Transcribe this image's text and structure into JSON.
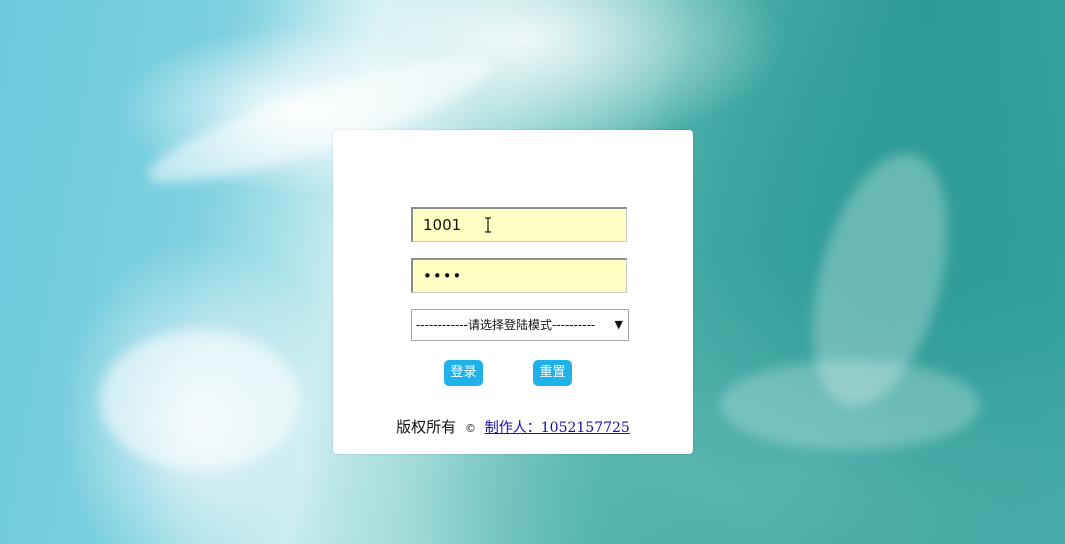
{
  "login_form": {
    "username_value": "1001",
    "password_value": "••••",
    "mode_select": {
      "selected": "------------请选择登陆模式----------"
    },
    "login_label": "登录",
    "reset_label": "重置"
  },
  "footer": {
    "rights_text": "版权所有",
    "copyright_symbol": "©",
    "author_link": "制作人：1052157725"
  },
  "colors": {
    "button": "#1eb2e8",
    "input_bg": "#ffffc4",
    "link": "#1a0dab"
  },
  "icons": {
    "cursor": "text-cursor-icon",
    "dropdown": "chevron-down-icon"
  }
}
